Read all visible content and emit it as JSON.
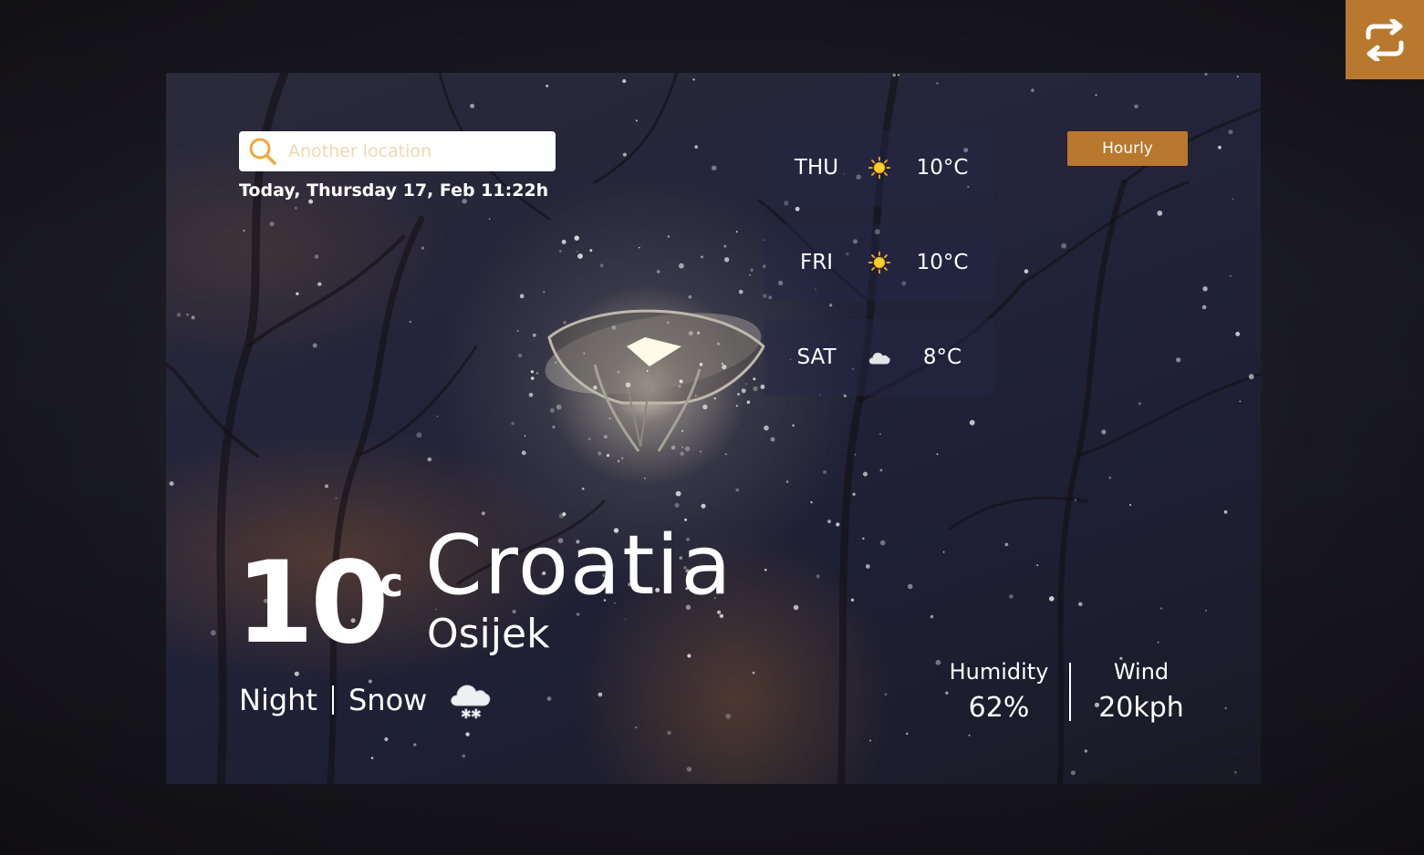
{
  "search": {
    "placeholder": "Another location"
  },
  "date_text": "Today, Thursday 17, Feb 11:22h",
  "hourly_label": "Hourly",
  "forecast": [
    {
      "day": "THU",
      "icon": "sun-icon",
      "temp": "10°C"
    },
    {
      "day": "FRI",
      "icon": "sun-icon",
      "temp": "10°C"
    },
    {
      "day": "SAT",
      "icon": "cloud-icon",
      "temp": "8°C"
    }
  ],
  "current": {
    "temperature": "10",
    "unit": "°c",
    "country": "Croatia",
    "city": "Osijek",
    "time_of_day": "Night",
    "condition": "Snow",
    "condition_icon": "snow-cloud-icon"
  },
  "stats": {
    "humidity_label": "Humidity",
    "humidity_value": "62%",
    "wind_label": "Wind",
    "wind_value": "20kph"
  },
  "colors": {
    "accent": "#b8782e",
    "search_icon": "#f0a83c",
    "placeholder": "#f1d8b0"
  },
  "icons": {
    "swap": "swap-arrows-icon",
    "search": "search-icon"
  }
}
